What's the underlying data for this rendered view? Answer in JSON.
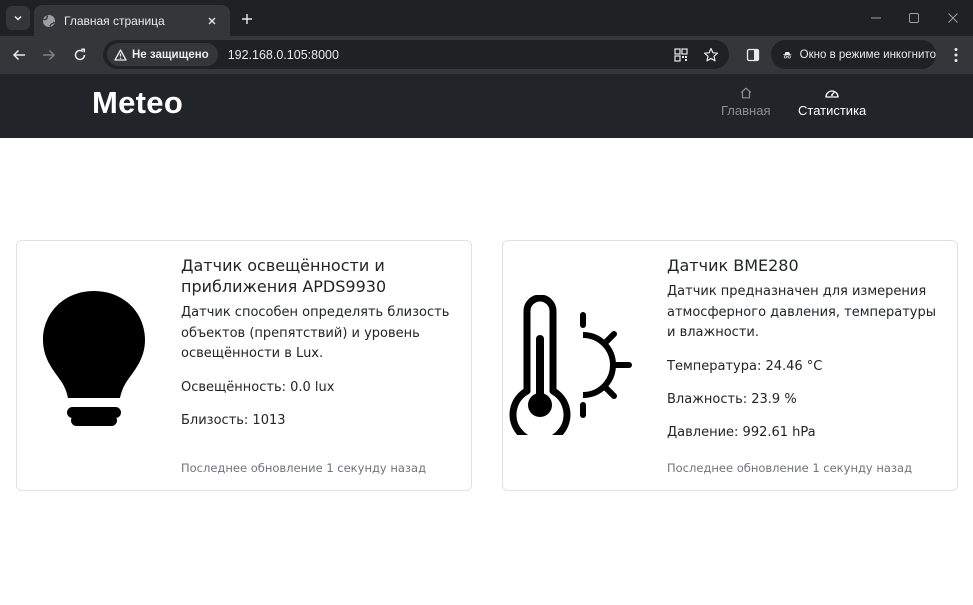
{
  "browser": {
    "tab": {
      "title": "Главная страница"
    },
    "address": {
      "security_label": "Не защищено",
      "url": "192.168.0.105:8000"
    },
    "incognito_label": "Окно в режиме инкогнито"
  },
  "site": {
    "brand": "Meteo",
    "nav": [
      {
        "label": "Главная",
        "icon": "home-icon",
        "active": false
      },
      {
        "label": "Статистика",
        "icon": "speedometer-icon",
        "active": true
      }
    ]
  },
  "cards": [
    {
      "icon": "lightbulb-icon",
      "title": "Датчик освещённости и приближения APDS9930",
      "description": "Датчик способен определять близость объектов (препятствий) и уровень освещённости в Lux.",
      "values": [
        "Освещённость: 0.0 lux",
        "Близость: 1013"
      ],
      "updated": "Последнее обновление 1 секунду назад"
    },
    {
      "icon": "thermometer-sun-icon",
      "title": "Датчик BME280",
      "description": "Датчик предназначен для измерения атмосферного давления, температуры и влажности.",
      "values": [
        "Температура: 24.46 °C",
        "Влажность: 23.9 %",
        "Давление: 992.61 hPa"
      ],
      "updated": "Последнее обновление 1 секунду назад"
    }
  ]
}
